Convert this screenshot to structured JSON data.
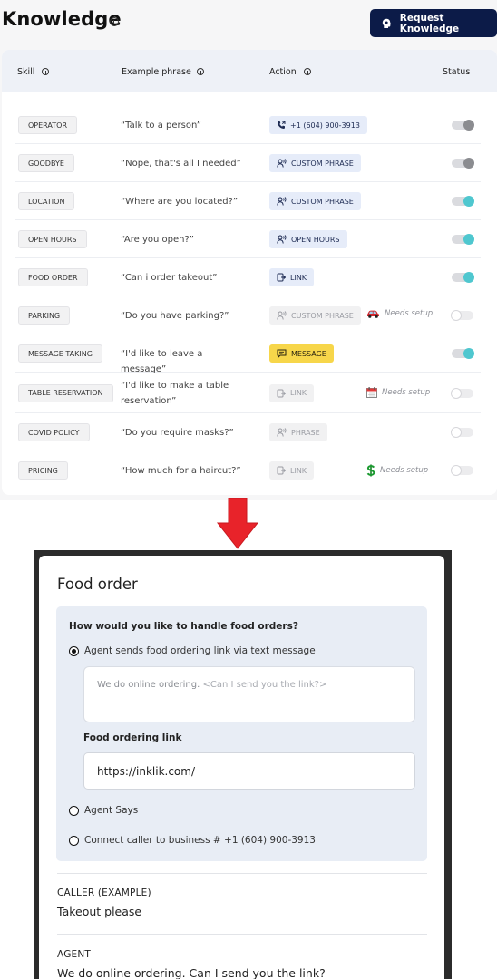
{
  "header": {
    "title": "Knowledge",
    "request_button": "Request Knowledge"
  },
  "table": {
    "columns": [
      "Skill",
      "Example phrase",
      "Action",
      "Status"
    ],
    "rows": [
      {
        "skill": "OPERATOR",
        "phrase": "“Talk to a person”",
        "action": "+1 (604) 900-3913",
        "action_icon": "phone-forward-icon",
        "action_state": "on",
        "setup": "",
        "setup_icon": "",
        "status": "grey"
      },
      {
        "skill": "GOODBYE",
        "phrase": "“Nope, that's all I needed”",
        "action": "CUSTOM PHRASE",
        "action_icon": "speaking-person-icon",
        "action_state": "on",
        "setup": "",
        "setup_icon": "",
        "status": "grey"
      },
      {
        "skill": "LOCATION",
        "phrase": "“Where are you located?”",
        "action": "CUSTOM PHRASE",
        "action_icon": "speaking-person-icon",
        "action_state": "on",
        "setup": "",
        "setup_icon": "",
        "status": "on"
      },
      {
        "skill": "OPEN HOURS",
        "phrase": "“Are you open?”",
        "action": "OPEN HOURS",
        "action_icon": "speaking-person-icon",
        "action_state": "on",
        "setup": "",
        "setup_icon": "",
        "status": "on"
      },
      {
        "skill": "FOOD ORDER",
        "phrase": "“Can i order takeout”",
        "action": "LINK",
        "action_icon": "link-out-icon",
        "action_state": "on",
        "setup": "",
        "setup_icon": "",
        "status": "on"
      },
      {
        "skill": "PARKING",
        "phrase": "“Do you have parking?”",
        "action": "CUSTOM PHRASE",
        "action_icon": "speaking-person-icon",
        "action_state": "off",
        "setup": "Needs setup",
        "setup_icon": "car-icon",
        "status": "off"
      },
      {
        "skill": "MESSAGE TAKING",
        "phrase": "“I'd like to leave a message”",
        "action": "MESSAGE",
        "action_icon": "message-icon",
        "action_state": "msg",
        "setup": "",
        "setup_icon": "",
        "status": "on"
      },
      {
        "skill": "TABLE RESERVATION",
        "phrase": "“I'd like to make a table reservation”",
        "action": "LINK",
        "action_icon": "link-out-icon",
        "action_state": "off",
        "setup": "Needs setup",
        "setup_icon": "calendar-icon",
        "status": "off"
      },
      {
        "skill": "COVID POLICY",
        "phrase": "“Do you require masks?”",
        "action": "PHRASE",
        "action_icon": "speaking-person-icon",
        "action_state": "off",
        "setup": "",
        "setup_icon": "",
        "status": "off"
      },
      {
        "skill": "PRICING",
        "phrase": "“How much for a haircut?”",
        "action": "LINK",
        "action_icon": "link-out-icon",
        "action_state": "off",
        "setup": "Needs setup",
        "setup_icon": "dollar-icon",
        "status": "off"
      }
    ]
  },
  "modal": {
    "title": "Food order",
    "question": "How would you like to handle food orders?",
    "option_link": "Agent sends food ordering link via text message",
    "message_text": "We do online ordering.",
    "message_placeholder": "<Can I send you the link?>",
    "link_label": "Food ordering link",
    "link_value": "https://inklik.com/",
    "option_says": "Agent Says",
    "option_connect": "Connect caller to business # +1 (604) 900-3913",
    "caller_label": "CALLER (EXAMPLE)",
    "caller_text": "Takeout please",
    "agent_label": "AGENT",
    "agent_text": "We do online ordering. Can I send you the link?"
  },
  "colors": {
    "brand_navy": "#0c1b48",
    "toggle_on": "#4fc7cf",
    "message_yellow": "#f7d64a",
    "arrow_red": "#e8232a"
  }
}
